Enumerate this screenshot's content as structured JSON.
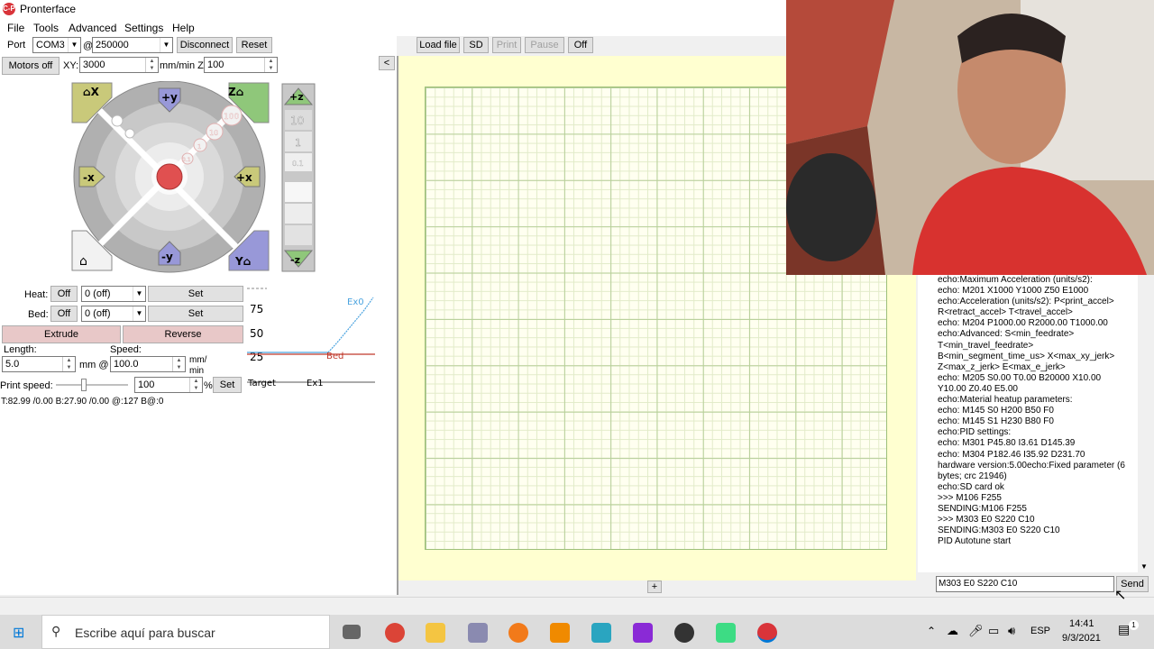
{
  "window": {
    "title": "Pronterface",
    "icon_text": "C-P"
  },
  "menu": [
    "File",
    "Tools",
    "Advanced",
    "Settings",
    "Help"
  ],
  "connection": {
    "port_label": "Port",
    "port_value": "COM3",
    "at": "@",
    "baud_value": "250000",
    "disconnect": "Disconnect",
    "reset": "Reset"
  },
  "print_controls": {
    "load_file": "Load file",
    "sd": "SD",
    "print": "Print",
    "pause": "Pause",
    "off": "Off"
  },
  "motion": {
    "motors_off": "Motors off",
    "xy_label": "XY:",
    "xy_value": "3000",
    "z_label": "mm/min Z:",
    "z_value": "100",
    "collapse": "<"
  },
  "jog": {
    "home_x": "X",
    "plus_y": "+y",
    "home_z": "Z",
    "minus_x": "-x",
    "plus_x": "+x",
    "minus_y": "-y",
    "home_y": "Y",
    "steps": [
      "100",
      "10",
      "1",
      "0.1"
    ],
    "z_plus": "+z",
    "z_minus": "-z",
    "z_steps": [
      "10",
      "1",
      "0.1"
    ]
  },
  "temps": {
    "heat_label": "Heat:",
    "heat_off": "Off",
    "heat_value": "0 (off)",
    "heat_set": "Set",
    "bed_label": "Bed:",
    "bed_off": "Off",
    "bed_value": "0 (off)",
    "bed_set": "Set"
  },
  "extrude": {
    "extrude": "Extrude",
    "reverse": "Reverse",
    "length_label": "Length:",
    "length_value": "5.0",
    "mm_at": "mm @",
    "speed_label": "Speed:",
    "speed_value": "100.0",
    "speed_unit": "mm/\nmin",
    "print_speed_label": "Print speed:",
    "print_speed_value": "100",
    "percent": "%",
    "set": "Set"
  },
  "temp_status": "T:82.99 /0.00 B:27.90 /0.00 @:127 B@:0",
  "graph": {
    "ticks": [
      "75",
      "50",
      "25"
    ],
    "legend_target": "Target",
    "legend_ex1": "Ex1",
    "label_ex0": "Ex0",
    "label_bed": "Bed",
    "colors": {
      "ex0": "#4aa3df",
      "bed": "#c0392b"
    }
  },
  "console": {
    "lines": [
      "echo:Maximum Acceleration (units/s2):",
      "echo:  M201 X1000 Y1000 Z50 E1000",
      "echo:Acceleration (units/s2): P<print_accel>",
      "R<retract_accel> T<travel_accel>",
      "echo:  M204 P1000.00 R2000.00 T1000.00",
      "echo:Advanced: S<min_feedrate>",
      "T<min_travel_feedrate>",
      "B<min_segment_time_us> X<max_xy_jerk>",
      "Z<max_z_jerk> E<max_e_jerk>",
      "echo:  M205 S0.00 T0.00 B20000 X10.00",
      "Y10.00 Z0.40 E5.00",
      "echo:Material heatup parameters:",
      "echo:  M145 S0 H200 B50 F0",
      "echo:  M145 S1 H230 B80 F0",
      "echo:PID settings:",
      "echo:  M301 P45.80 I3.61 D145.39",
      "echo:  M304 P182.46 I35.92 D231.70",
      " hardware version:5.00echo:Fixed parameter (6",
      "bytes; crc 21946)",
      "echo:SD card ok",
      ">>> M106 F255",
      "SENDING:M106 F255",
      ">>> M303 E0 S220 C10",
      "SENDING:M303 E0 S220 C10",
      "PID Autotune start"
    ],
    "command_value": "M303 E0 S220 C10",
    "send": "Send"
  },
  "layer_plus": "+",
  "taskbar": {
    "search_placeholder": "Escribe aquí para buscar",
    "lang": "ESP",
    "time": "14:41",
    "date": "9/3/2021",
    "notifications": "1"
  }
}
